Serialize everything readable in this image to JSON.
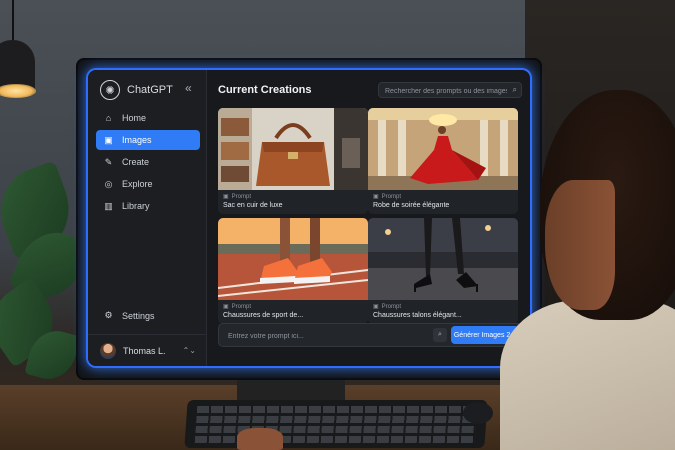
{
  "app": {
    "name": "ChatGPT"
  },
  "sidebar": {
    "items": [
      {
        "label": "Home",
        "icon": "home-icon",
        "active": false
      },
      {
        "label": "Images",
        "icon": "image-icon",
        "active": true
      },
      {
        "label": "Create",
        "icon": "wand-icon",
        "active": false
      },
      {
        "label": "Explore",
        "icon": "compass-icon",
        "active": false
      },
      {
        "label": "Library",
        "icon": "library-icon",
        "active": false
      }
    ],
    "settings_label": "Settings",
    "user_name": "Thomas L."
  },
  "main": {
    "title": "Current Creations",
    "search_placeholder": "Rechercher des prompts ou des images...",
    "cards": [
      {
        "prompt_label": "Prompt",
        "caption": "Sac en cuir de luxe"
      },
      {
        "prompt_label": "Prompt",
        "caption": "Robe de soirée élégante"
      },
      {
        "prompt_label": "Prompt",
        "caption": "Chaussures de sport de..."
      },
      {
        "prompt_label": "Prompt",
        "caption": "Chaussures talons élégant..."
      }
    ],
    "prompt_placeholder": "Entrez votre prompt ici...",
    "generate_label": "Générer Images 2.5"
  },
  "colors": {
    "accent": "#2f7cf6",
    "glow": "#3882ff",
    "screen_bg": "#17191d"
  }
}
